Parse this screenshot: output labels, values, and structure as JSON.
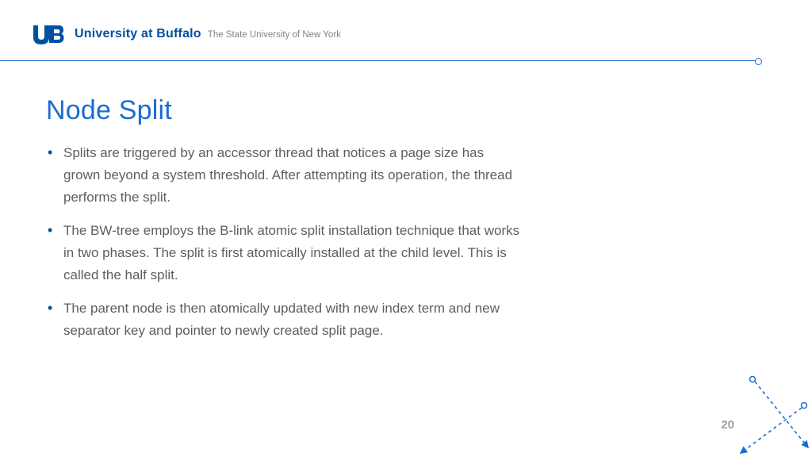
{
  "header": {
    "university_name": "University at Buffalo",
    "suny_text": "The State University of New York"
  },
  "slide": {
    "title": "Node Split",
    "bullets": [
      "Splits are triggered by an accessor thread that notices a page size has grown beyond a system threshold. After attempting its operation, the thread performs the split.",
      "The BW-tree employs the B-link atomic split installation technique that works in two phases. The split is first atomically installed at the child level. This is called the half split.",
      "The parent node is then atomically updated with new index term and new separator key and pointer to newly created split page."
    ]
  },
  "page_number": "20",
  "colors": {
    "ub_blue": "#0050a0",
    "accent": "#1a6dd0"
  }
}
